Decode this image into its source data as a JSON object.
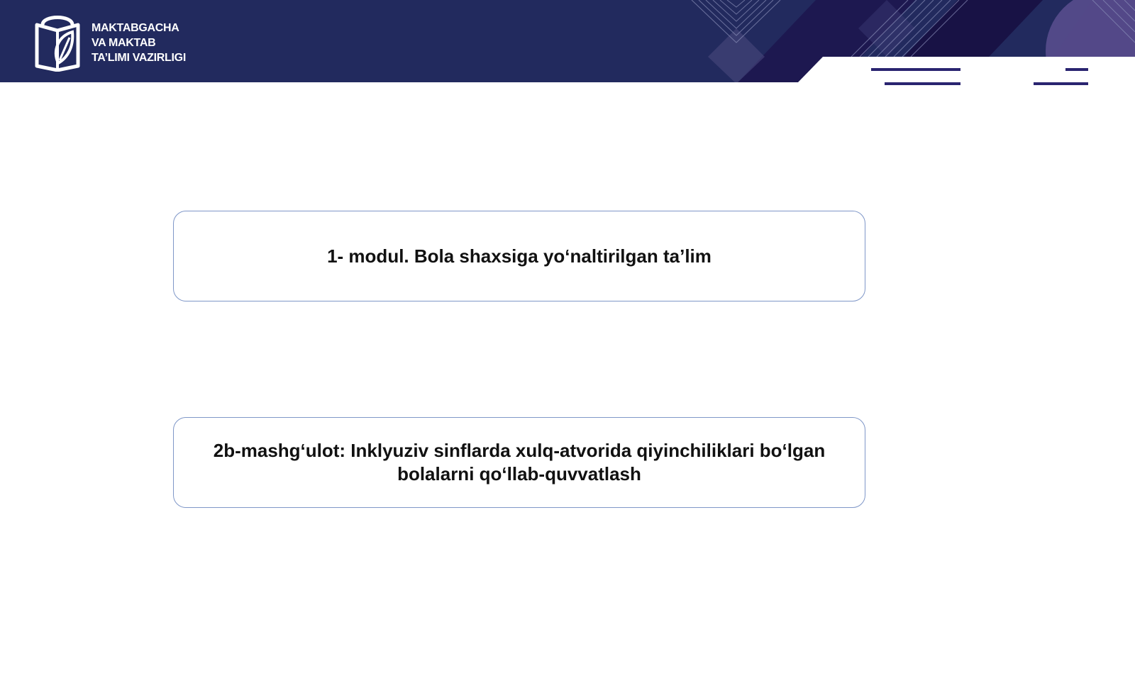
{
  "header": {
    "ministry_name_lines": [
      "MAKTABGACHA",
      "VA MAKTAB",
      "TA’LIMI VAZIRLIGI"
    ],
    "logo_icon": "open-book-leaf-icon",
    "colors": {
      "header_background": "#222a5e",
      "accent_purple": "#5b4f8f",
      "accent_dark": "#1a1448",
      "line_accent": "#2a2470"
    }
  },
  "module_box": {
    "text": "1- modul. Bola shaxsiga yo‘naltirilgan ta’lim"
  },
  "lesson_box": {
    "lines": [
      "2b-mashg‘ulot: Inklyuziv sinflarda xulq-atvorida qiyinchiliklari bo‘lgan",
      "bolalarni qo‘llab-quvvatlash"
    ]
  },
  "box_border_color": "#7f97c8"
}
